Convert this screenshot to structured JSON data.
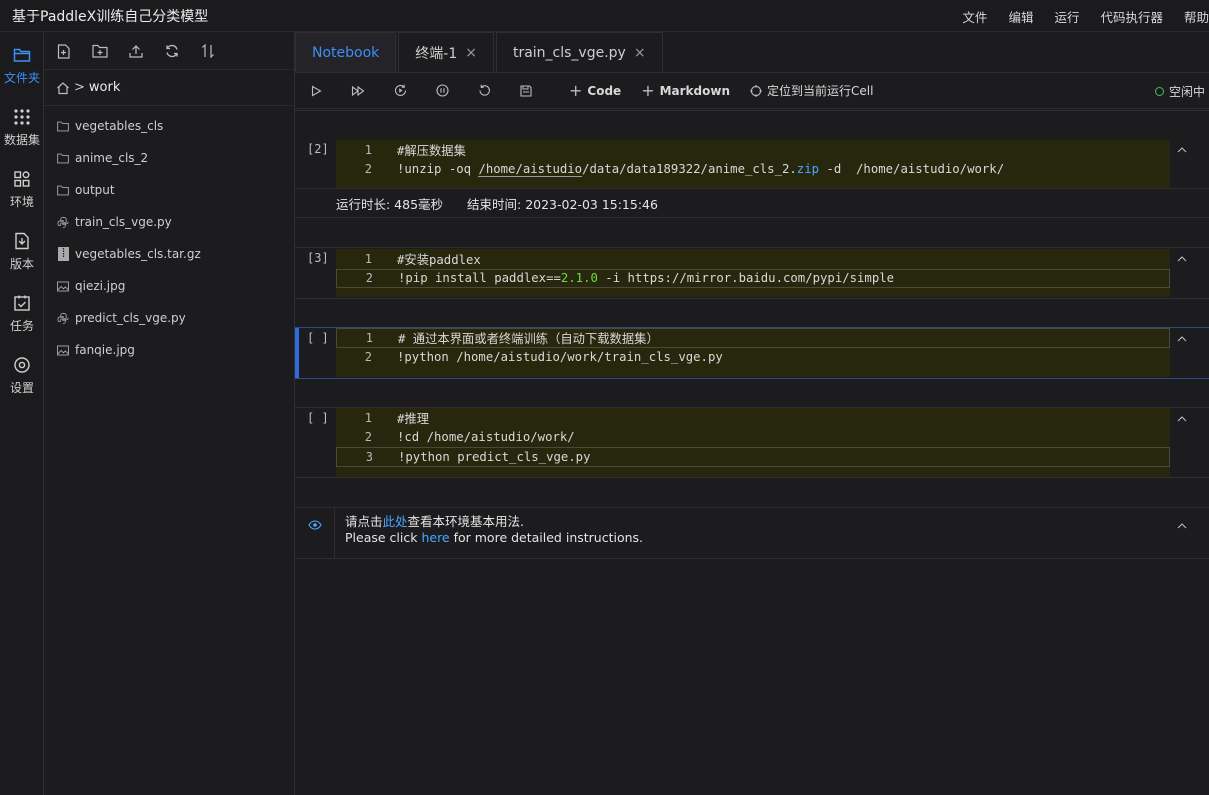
{
  "app": {
    "title": "基于PaddleX训练自己分类模型",
    "menu": [
      "文件",
      "编辑",
      "运行",
      "代码执行器",
      "帮助"
    ]
  },
  "activity": [
    {
      "label": "文件夹",
      "icon": "folder-icon",
      "active": true
    },
    {
      "label": "数据集",
      "icon": "dataset-icon"
    },
    {
      "label": "环境",
      "icon": "environment-icon"
    },
    {
      "label": "版本",
      "icon": "version-icon"
    },
    {
      "label": "任务",
      "icon": "task-icon"
    },
    {
      "label": "设置",
      "icon": "settings-icon"
    }
  ],
  "filepanel": {
    "toolbar_icons": [
      "new-file-icon",
      "new-folder-icon",
      "upload-icon",
      "refresh-icon",
      "sort-icon"
    ],
    "path": {
      "separator": ">",
      "dir": "work"
    },
    "files": [
      {
        "name": "vegetables_cls",
        "type": "folder"
      },
      {
        "name": "anime_cls_2",
        "type": "folder"
      },
      {
        "name": "output",
        "type": "folder"
      },
      {
        "name": "train_cls_vge.py",
        "type": "python"
      },
      {
        "name": "vegetables_cls.tar.gz",
        "type": "archive"
      },
      {
        "name": "qiezi.jpg",
        "type": "image"
      },
      {
        "name": "predict_cls_vge.py",
        "type": "python"
      },
      {
        "name": "fanqie.jpg",
        "type": "image"
      }
    ]
  },
  "tabs": [
    {
      "label": "Notebook",
      "active": true,
      "closable": false
    },
    {
      "label": "终端-1",
      "closable": true
    },
    {
      "label": "train_cls_vge.py",
      "closable": true
    }
  ],
  "tab_close": "×",
  "notebook_toolbar": {
    "icons": [
      "run-icon",
      "run-all-icon",
      "restart-run-icon",
      "interrupt-icon",
      "restart-icon",
      "save-icon"
    ],
    "add_code": "Code",
    "add_markdown": "Markdown",
    "locate": "定位到当前运行Cell",
    "status": "空闲中",
    "plus": "+"
  },
  "cells": [
    {
      "prompt": "[2]",
      "lines": [
        {
          "n": "1",
          "text": "#解压数据集"
        },
        {
          "n": "2",
          "text": "!unzip -oq /home/aistudio/data/data189322/anime_cls_2.zip -d  /home/aistudio/work/"
        }
      ],
      "output": {
        "duration": "运行时长: 485毫秒",
        "end_time": "结束时间: 2023-02-03 15:15:46"
      }
    },
    {
      "prompt": "[3]",
      "lines": [
        {
          "n": "1",
          "text": "#安装paddlex"
        },
        {
          "n": "2",
          "text": "!pip install paddlex==2.1.0 -i https://mirror.baidu.com/pypi/simple"
        }
      ]
    },
    {
      "prompt": "[ ]",
      "lines": [
        {
          "n": "1",
          "text": "# 通过本界面或者终端训练（自动下载数据集）"
        },
        {
          "n": "2",
          "text": "!python /home/aistudio/work/train_cls_vge.py"
        }
      ]
    },
    {
      "prompt": "[ ]",
      "lines": [
        {
          "n": "1",
          "text": "#推理"
        },
        {
          "n": "2",
          "text": "!cd /home/aistudio/work/"
        },
        {
          "n": "3",
          "text": "!python predict_cls_vge.py"
        }
      ]
    }
  ],
  "code_parts": {
    "c1l2_a": "!unzip -oq ",
    "c1l2_b": "/home/aistudio",
    "c1l2_c": "/data/data189322/anime_cls_2.",
    "c1l2_d": "zip",
    "c1l2_e": " -d  /home/aistudio/work/",
    "c2l2_a": "!pip install paddlex==",
    "c2l2_b": "2.1.0",
    "c2l2_c": " -i https://mirror.baidu.com/pypi/simple"
  },
  "info": {
    "line1_pre": "请点击",
    "line1_link": "此处",
    "line1_post": "查看本环境基本用法.",
    "line2_pre": "Please click ",
    "line2_link": "here",
    "line2_post": " for more detailed instructions."
  },
  "colors": {
    "accent": "#3e8ef7",
    "comment": "#6fdb3f",
    "cell_bg": "#27270e",
    "status": "#3fbf5f"
  }
}
